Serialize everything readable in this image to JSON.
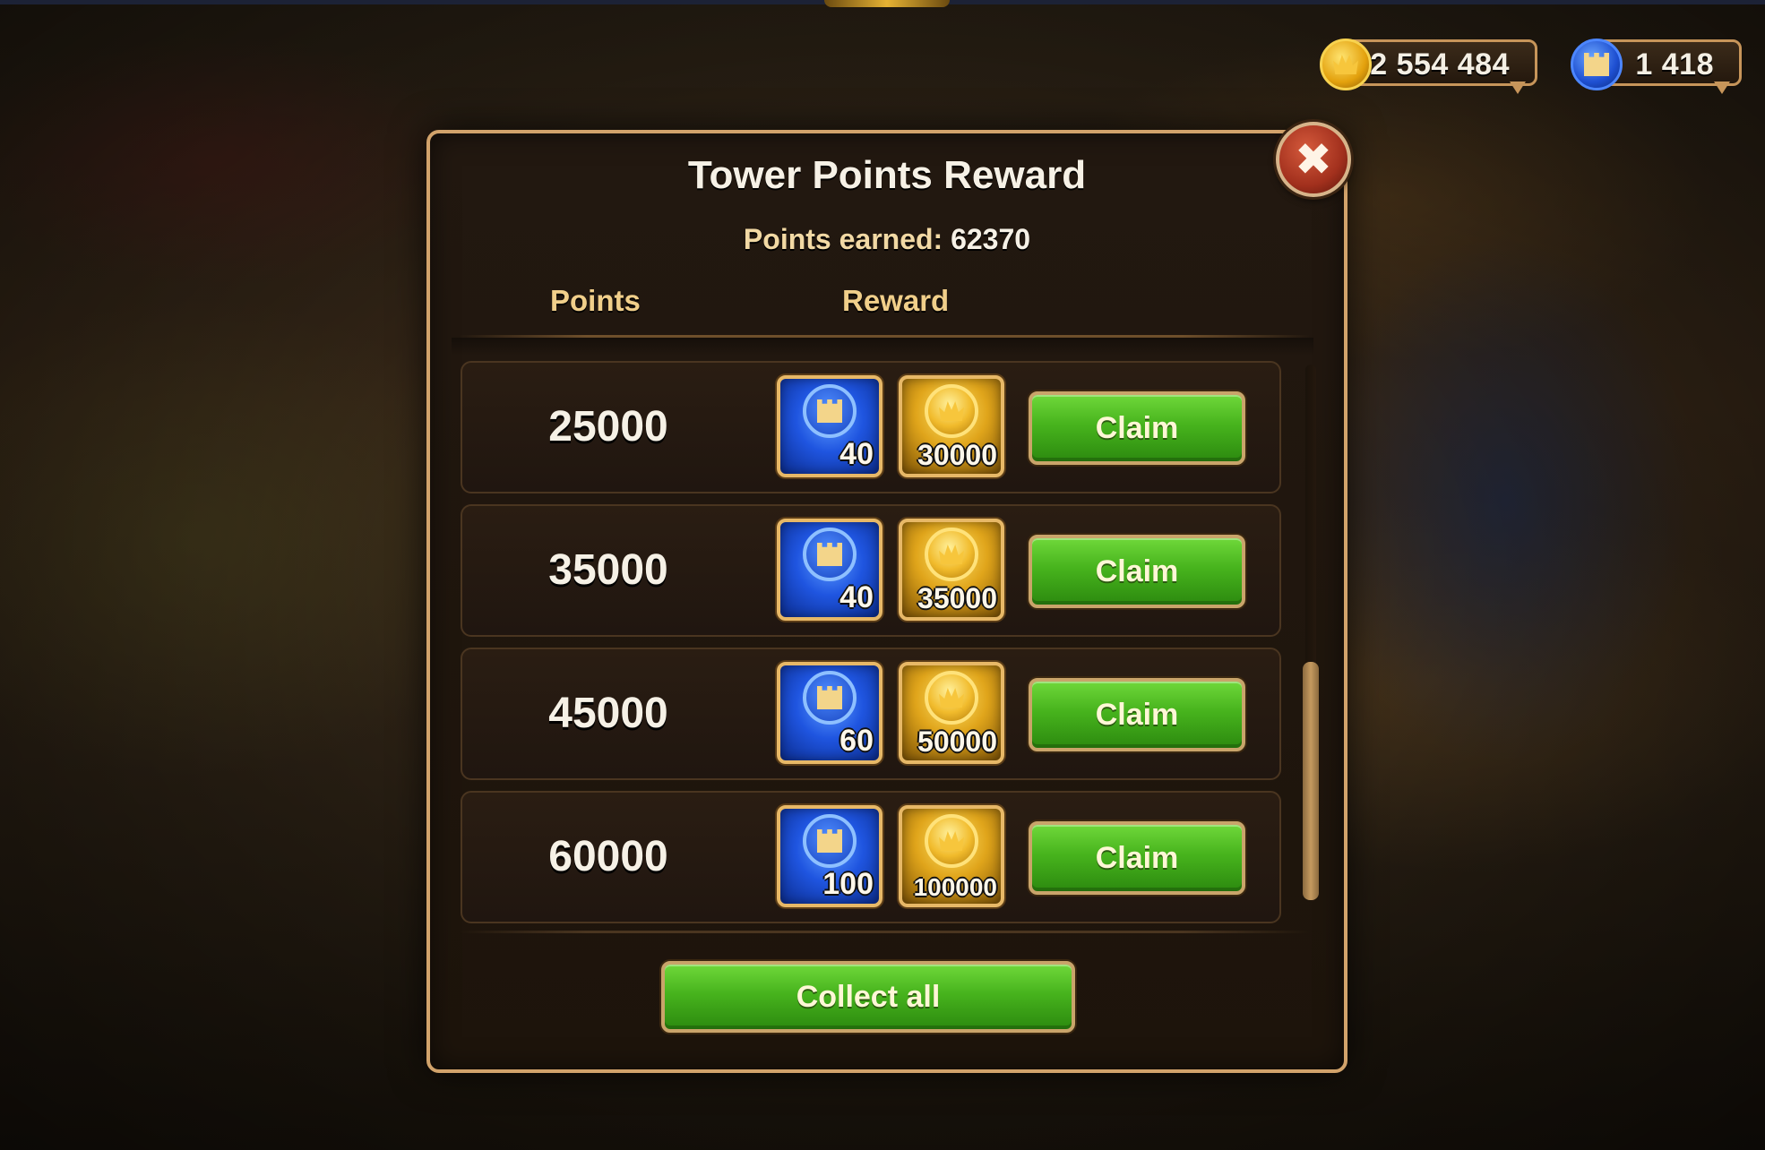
{
  "currencies": {
    "gold": {
      "icon": "gold-coin-icon",
      "value": "2 554 484"
    },
    "tower_points": {
      "icon": "tower-coin-icon",
      "value": "1 418"
    }
  },
  "modal": {
    "title": "Tower Points Reward",
    "points_earned_label": "Points earned:",
    "points_earned_value": "62370",
    "close_icon": "close-icon",
    "columns": {
      "points": "Points",
      "reward": "Reward"
    },
    "rows": [
      {
        "points": "25000",
        "tower_reward": "40",
        "gold_reward": "30000",
        "claim_label": "Claim"
      },
      {
        "points": "35000",
        "tower_reward": "40",
        "gold_reward": "35000",
        "claim_label": "Claim"
      },
      {
        "points": "45000",
        "tower_reward": "60",
        "gold_reward": "50000",
        "claim_label": "Claim"
      },
      {
        "points": "60000",
        "tower_reward": "100",
        "gold_reward": "100000",
        "claim_label": "Claim"
      }
    ],
    "collect_all_label": "Collect all"
  },
  "colors": {
    "frame_border": "#d2a36b",
    "claim_green": "#47b31d",
    "title_text": "#f6f1e6",
    "header_gold": "#f1cf8a"
  }
}
